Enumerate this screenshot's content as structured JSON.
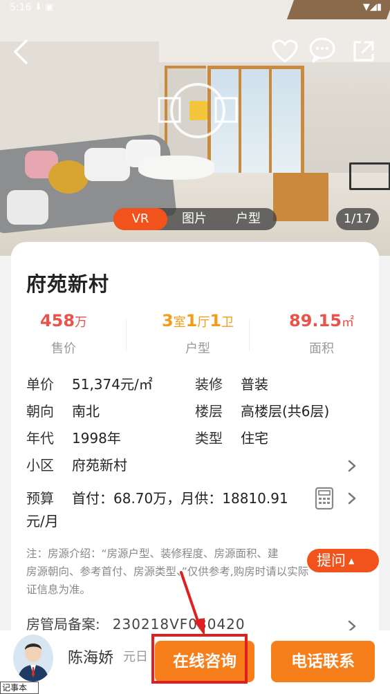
{
  "status_bar": {
    "time": "5:16"
  },
  "media": {
    "tabs": [
      "VR",
      "图片",
      "户型"
    ],
    "active_tab": "VR",
    "counter": "1/17"
  },
  "listing": {
    "title": "府苑新村",
    "stats": {
      "price": {
        "value": "458",
        "unit": "万",
        "label": "售价"
      },
      "layout": {
        "rooms": "3",
        "rooms_unit": "室",
        "halls": "1",
        "halls_unit": "厅",
        "baths": "1",
        "baths_unit": "卫",
        "label": "户型"
      },
      "area": {
        "value": "89.15",
        "unit": "㎡",
        "label": "面积"
      }
    },
    "attributes": {
      "unit_price": {
        "key": "单价",
        "value": "51,374元/㎡"
      },
      "decoration": {
        "key": "装修",
        "value": "普装"
      },
      "orientation": {
        "key": "朝向",
        "value": "南北"
      },
      "floor": {
        "key": "楼层",
        "value": "高楼层(共6层)"
      },
      "year": {
        "key": "年代",
        "value": "1998年"
      },
      "type": {
        "key": "类型",
        "value": "住宅"
      },
      "community": {
        "key": "小区",
        "value": "府苑新村"
      },
      "budget": {
        "key": "预算",
        "value": "首付：68.70万，月供：18810.91",
        "value_line2": "元/月"
      }
    },
    "note": "注：房源介绍：“房源户型、装修程度、房源面积、建…房源朝向、参考首付、房源类型…”仅供参考,购房时请以实际…证信息为准。",
    "note_line1": "注：房源介绍：“房源户型、装修程度、房源面积、建",
    "note_line2": "房源朝向、参考首付、房源类型、”仅供参考,购房时请以实际",
    "note_line3": "证信息为准。",
    "record": {
      "key": "房管局备案:",
      "value": "230218VF030420"
    }
  },
  "ask_button": {
    "label": "提问"
  },
  "agent": {
    "name": "陈海娇",
    "sub": "元日"
  },
  "actions": {
    "online": "在线咨询",
    "phone": "电话联系"
  },
  "memo_tag": "记事本",
  "colors": {
    "accent": "#f2531c",
    "price_red": "#e8534a",
    "layout_orange": "#f39c1a",
    "button_orange": "#f77f1b",
    "highlight_red": "#e02020"
  }
}
